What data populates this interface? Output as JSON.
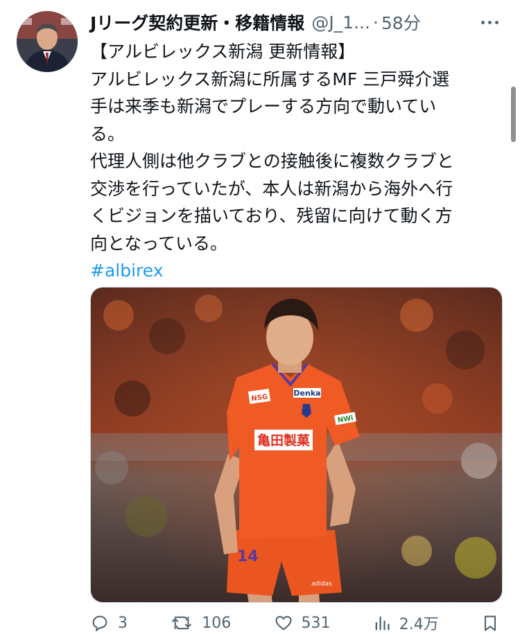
{
  "tweet": {
    "author_name": "Jリーグ契約更新・移籍情報",
    "handle": "@J_1...",
    "separator": "·",
    "time": "58分",
    "lines": [
      "【アルビレックス新潟 更新情報】",
      "アルビレックス新潟に所属するMF 三戸舜介選",
      "手は来季も新潟でプレーする方向で動いてい",
      "る。",
      "代理人側は他クラブとの接触後に複数クラブと",
      "交渉を行っていたが、本人は新潟から海外へ行",
      "くビジョンを描いており、残留に向けて動く方",
      "向となっている。"
    ],
    "hashtag": "#albirex"
  },
  "photo": {
    "sponsor_chest": "亀田製菓",
    "sponsor_top": "Denka",
    "sponsor_sleeve": "NSG",
    "sponsor_right": "NWi",
    "number": "14",
    "brand": "adidas"
  },
  "actions": {
    "replies": "3",
    "retweets": "106",
    "likes": "531",
    "views": "2.4万"
  },
  "colors": {
    "link": "#1d9bf0",
    "secondary": "#536471",
    "jersey": "#f05a24"
  }
}
